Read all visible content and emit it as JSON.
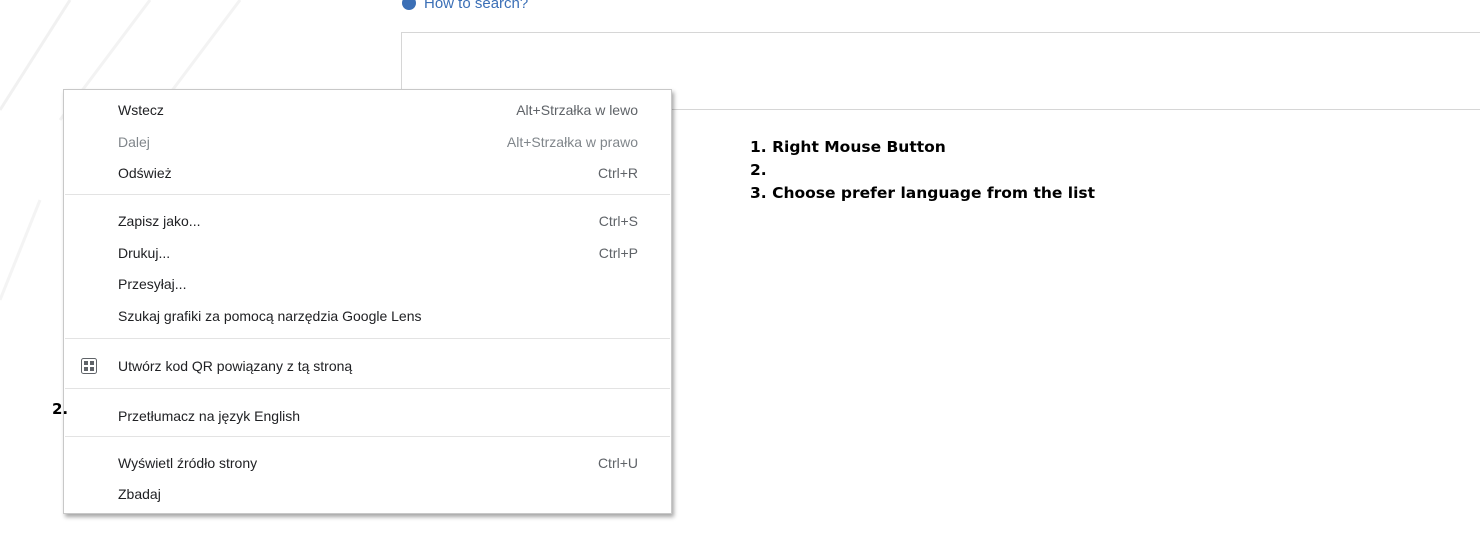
{
  "page": {
    "how_to_search": "How to search?",
    "instructions": [
      "1. Right Mouse Button",
      "2.",
      "3. Choose prefer language from the list"
    ],
    "step_marker": "2."
  },
  "context_menu": {
    "items": [
      {
        "label": "Wstecz",
        "shortcut": "Alt+Strzałka w lewo",
        "disabled": false
      },
      {
        "label": "Dalej",
        "shortcut": "Alt+Strzałka w prawo",
        "disabled": true
      },
      {
        "label": "Odśwież",
        "shortcut": "Ctrl+R",
        "disabled": false
      },
      {
        "label": "Zapisz jako...",
        "shortcut": "Ctrl+S",
        "disabled": false
      },
      {
        "label": "Drukuj...",
        "shortcut": "Ctrl+P",
        "disabled": false
      },
      {
        "label": "Przesyłaj...",
        "shortcut": "",
        "disabled": false
      },
      {
        "label": "Szukaj grafiki za pomocą narzędzia Google Lens",
        "shortcut": "",
        "disabled": false
      },
      {
        "label": "Utwórz kod QR powiązany z tą stroną",
        "shortcut": "",
        "disabled": false,
        "icon": "qr-code-icon"
      },
      {
        "label": "Przetłumacz na język English",
        "shortcut": "",
        "disabled": false
      },
      {
        "label": "Wyświetl źródło strony",
        "shortcut": "Ctrl+U",
        "disabled": false
      },
      {
        "label": "Zbadaj",
        "shortcut": "",
        "disabled": false
      }
    ]
  },
  "colors": {
    "link_blue": "#3b6fb6",
    "menu_text": "#202124",
    "disabled_text": "#80868b",
    "separator": "#e3e3e3"
  }
}
